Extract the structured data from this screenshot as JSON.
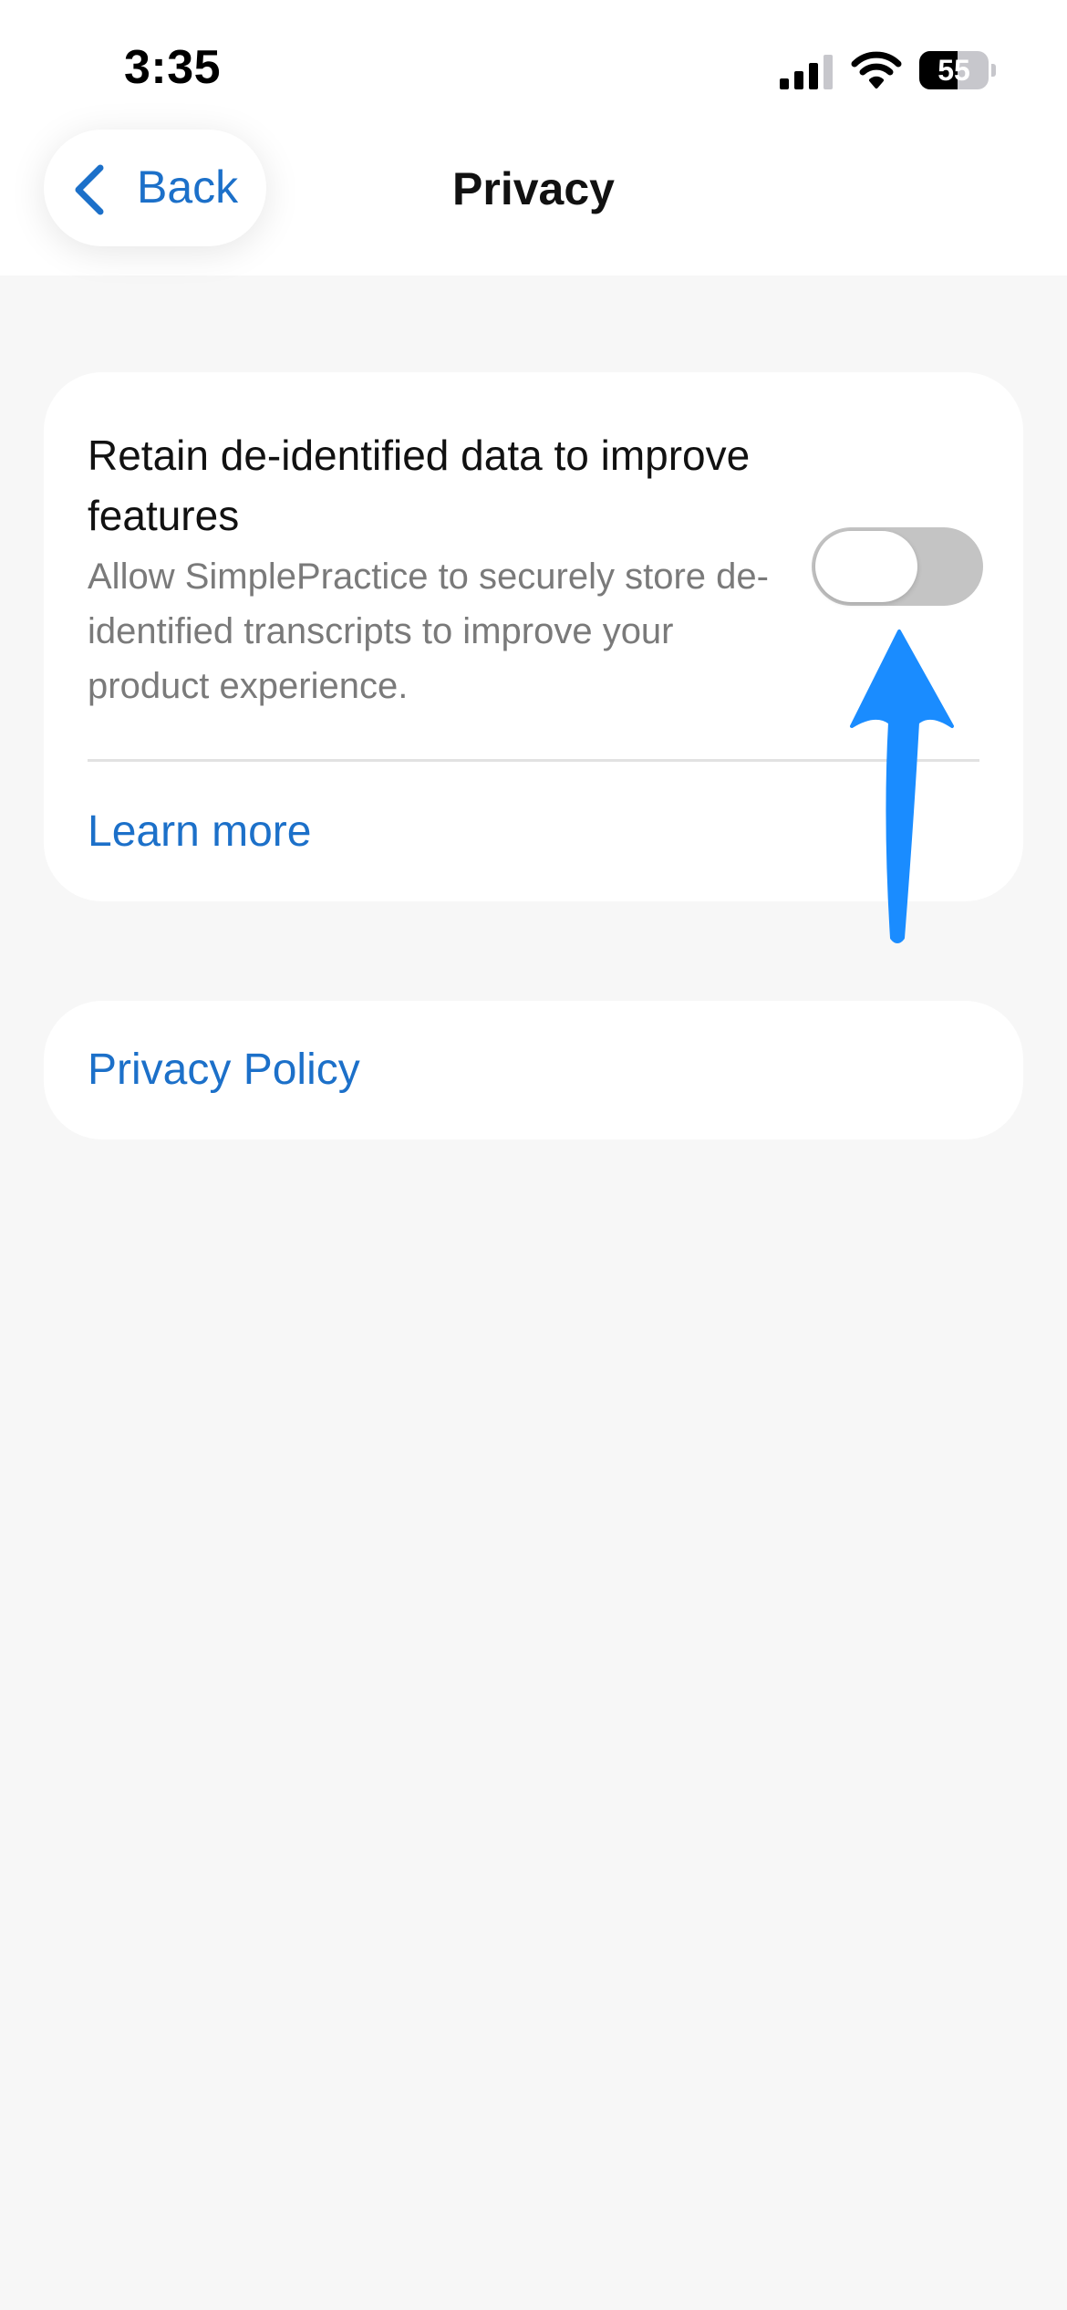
{
  "status_bar": {
    "time": "3:35",
    "battery_level": "55",
    "battery_percent": 55,
    "icons": [
      "cellular-signal-icon",
      "wifi-icon",
      "battery-icon"
    ]
  },
  "nav": {
    "back_label": "Back",
    "title": "Privacy",
    "back_icon": "chevron-left-icon"
  },
  "data_setting": {
    "title": "Retain de-identified data to improve features",
    "description": "Allow SimplePractice to securely store de-identified transcripts to improve your product experience.",
    "toggle_on": false,
    "learn_more_label": "Learn more"
  },
  "policy": {
    "label": "Privacy Policy"
  },
  "annotation": {
    "icon": "up-arrow-annotation-icon",
    "color": "#1a8cff"
  },
  "colors": {
    "accent": "#1c70c9",
    "background": "#f7f7f7",
    "toggle_off": "#c4c4c4"
  }
}
